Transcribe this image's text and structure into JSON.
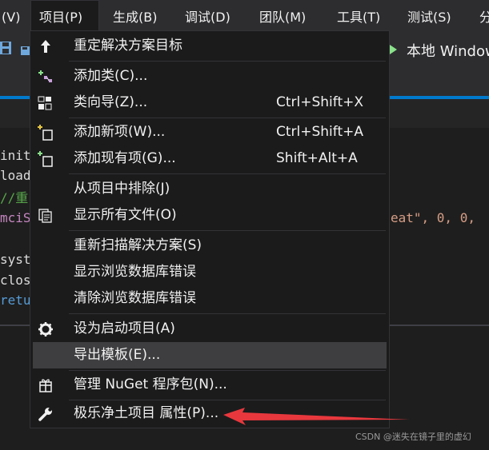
{
  "menubar": {
    "items": [
      {
        "label": "(V)"
      },
      {
        "label": "项目(P)"
      },
      {
        "label": "生成(B)"
      },
      {
        "label": "调试(D)"
      },
      {
        "label": "团队(M)"
      },
      {
        "label": "工具(T)"
      },
      {
        "label": "测试(S)"
      },
      {
        "label": "分"
      }
    ]
  },
  "toolbar": {
    "run_label": "本地 Window",
    "icons": [
      "save-icon",
      "save-all-icon",
      "run-icon"
    ]
  },
  "code_fragments": [
    {
      "text": "init",
      "color": "#dcdcaa"
    },
    {
      "text": "load",
      "color": "#dcdcaa"
    },
    {
      "text": "//重",
      "color": "#57a64a"
    },
    {
      "text": "mciS",
      "color": "#c586c0"
    },
    {
      "text": "eat\", 0, 0,",
      "color": "#d69d85"
    },
    {
      "text": "syst",
      "color": "#dcdcaa"
    },
    {
      "text": "clos",
      "color": "#dcdcaa"
    },
    {
      "text": "retu",
      "color": "#569cd6"
    }
  ],
  "menu": {
    "items": [
      {
        "icon": "arrow-up-icon",
        "label": "重定解决方案目标",
        "shortcut": ""
      },
      {
        "icon": "add-class-icon",
        "label": "添加类(C)...",
        "shortcut": ""
      },
      {
        "icon": "class-wizard-icon",
        "label": "类向导(Z)...",
        "shortcut": "Ctrl+Shift+X"
      },
      {
        "icon": "add-new-item-icon",
        "label": "添加新项(W)...",
        "shortcut": "Ctrl+Shift+A"
      },
      {
        "icon": "add-existing-item-icon",
        "label": "添加现有项(G)...",
        "shortcut": "Shift+Alt+A"
      },
      {
        "icon": "",
        "label": "从项目中排除(J)",
        "shortcut": ""
      },
      {
        "icon": "show-all-files-icon",
        "label": "显示所有文件(O)",
        "shortcut": ""
      },
      {
        "icon": "",
        "label": "重新扫描解决方案(S)",
        "shortcut": ""
      },
      {
        "icon": "",
        "label": "显示浏览数据库错误",
        "shortcut": ""
      },
      {
        "icon": "",
        "label": "清除浏览数据库错误",
        "shortcut": ""
      },
      {
        "icon": "gear-icon",
        "label": "设为启动项目(A)",
        "shortcut": ""
      },
      {
        "icon": "",
        "label": "导出模板(E)...",
        "shortcut": ""
      },
      {
        "icon": "nuget-package-icon",
        "label": "管理 NuGet 程序包(N)...",
        "shortcut": ""
      },
      {
        "icon": "wrench-icon",
        "label": "极乐净土项目 属性(P)...",
        "shortcut": ""
      }
    ]
  },
  "watermark": "CSDN @迷失在镜子里的虚幻",
  "colors": {
    "accent": "#007acc",
    "menu_bg": "#1b1b1c",
    "highlight": "#3e3e40",
    "annotation_arrow": "#e8383d"
  }
}
